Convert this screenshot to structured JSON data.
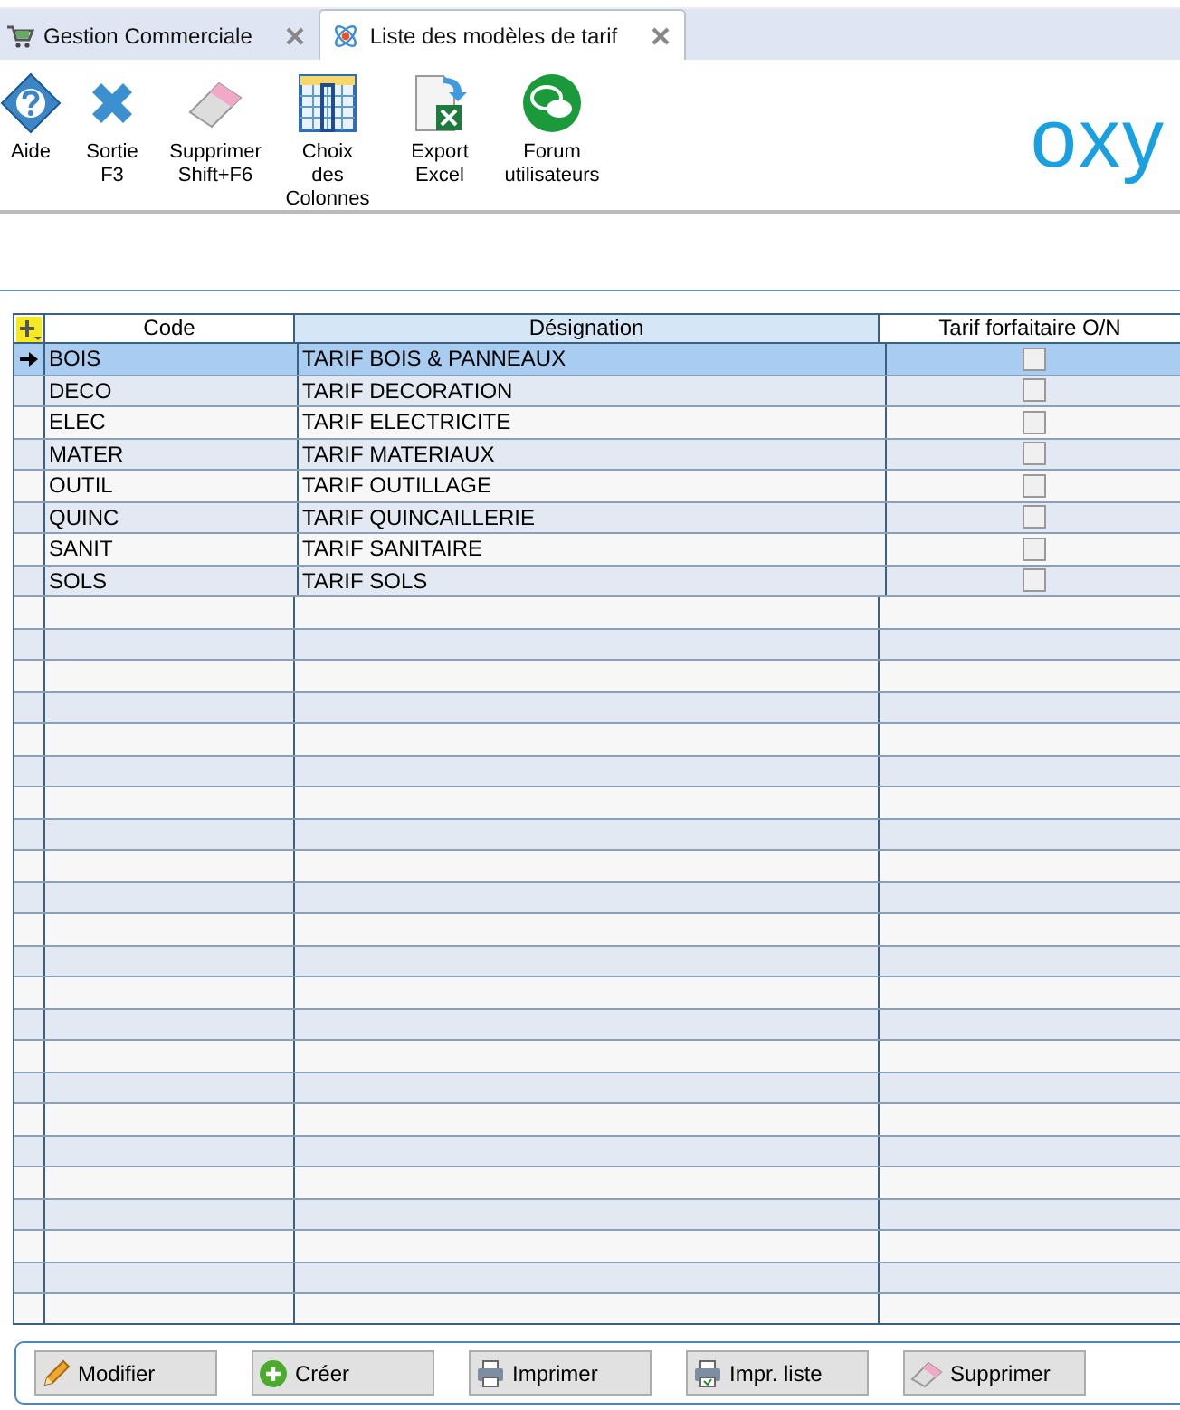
{
  "tabs": [
    {
      "label": "Gestion Commerciale",
      "kind": "cart",
      "selected": false
    },
    {
      "label": "Liste des modèles de tarif",
      "kind": "atom",
      "selected": true
    }
  ],
  "toolbar": [
    {
      "kind": "help",
      "label": [
        "Aide"
      ]
    },
    {
      "kind": "exit",
      "label": [
        "Sortie",
        "F3"
      ]
    },
    {
      "kind": "eraser",
      "label": [
        "Supprimer",
        "Shift+F6"
      ]
    },
    {
      "kind": "columns",
      "label": [
        "Choix",
        "des",
        "Colonnes"
      ]
    },
    {
      "kind": "excel",
      "label": [
        "Export",
        "Excel"
      ]
    },
    {
      "kind": "forum",
      "label": [
        "Forum",
        "utilisateurs"
      ]
    }
  ],
  "logo": "oxy",
  "table": {
    "columns": [
      "Code",
      "Désignation",
      "Tarif forfaitaire O/N"
    ],
    "rows": [
      {
        "code": "BOIS",
        "designation": "TARIF BOIS & PANNEAUX",
        "checked": false,
        "selected": true
      },
      {
        "code": "DECO",
        "designation": "TARIF DECORATION",
        "checked": false,
        "selected": false
      },
      {
        "code": "ELEC",
        "designation": "TARIF ELECTRICITE",
        "checked": false,
        "selected": false
      },
      {
        "code": "MATER",
        "designation": "TARIF MATERIAUX",
        "checked": false,
        "selected": false
      },
      {
        "code": "OUTIL",
        "designation": "TARIF OUTILLAGE",
        "checked": false,
        "selected": false
      },
      {
        "code": "QUINC",
        "designation": "TARIF QUINCAILLERIE",
        "checked": false,
        "selected": false
      },
      {
        "code": "SANIT",
        "designation": "TARIF SANITAIRE",
        "checked": false,
        "selected": false
      },
      {
        "code": "SOLS",
        "designation": "TARIF SOLS",
        "checked": false,
        "selected": false
      }
    ]
  },
  "buttons": [
    {
      "kind": "pencil",
      "label": "Modifier"
    },
    {
      "kind": "plus",
      "label": "Créer"
    },
    {
      "kind": "printer",
      "label": "Imprimer"
    },
    {
      "kind": "printlist",
      "label": "Impr. liste"
    },
    {
      "kind": "eraser",
      "label": "Supprimer"
    }
  ]
}
